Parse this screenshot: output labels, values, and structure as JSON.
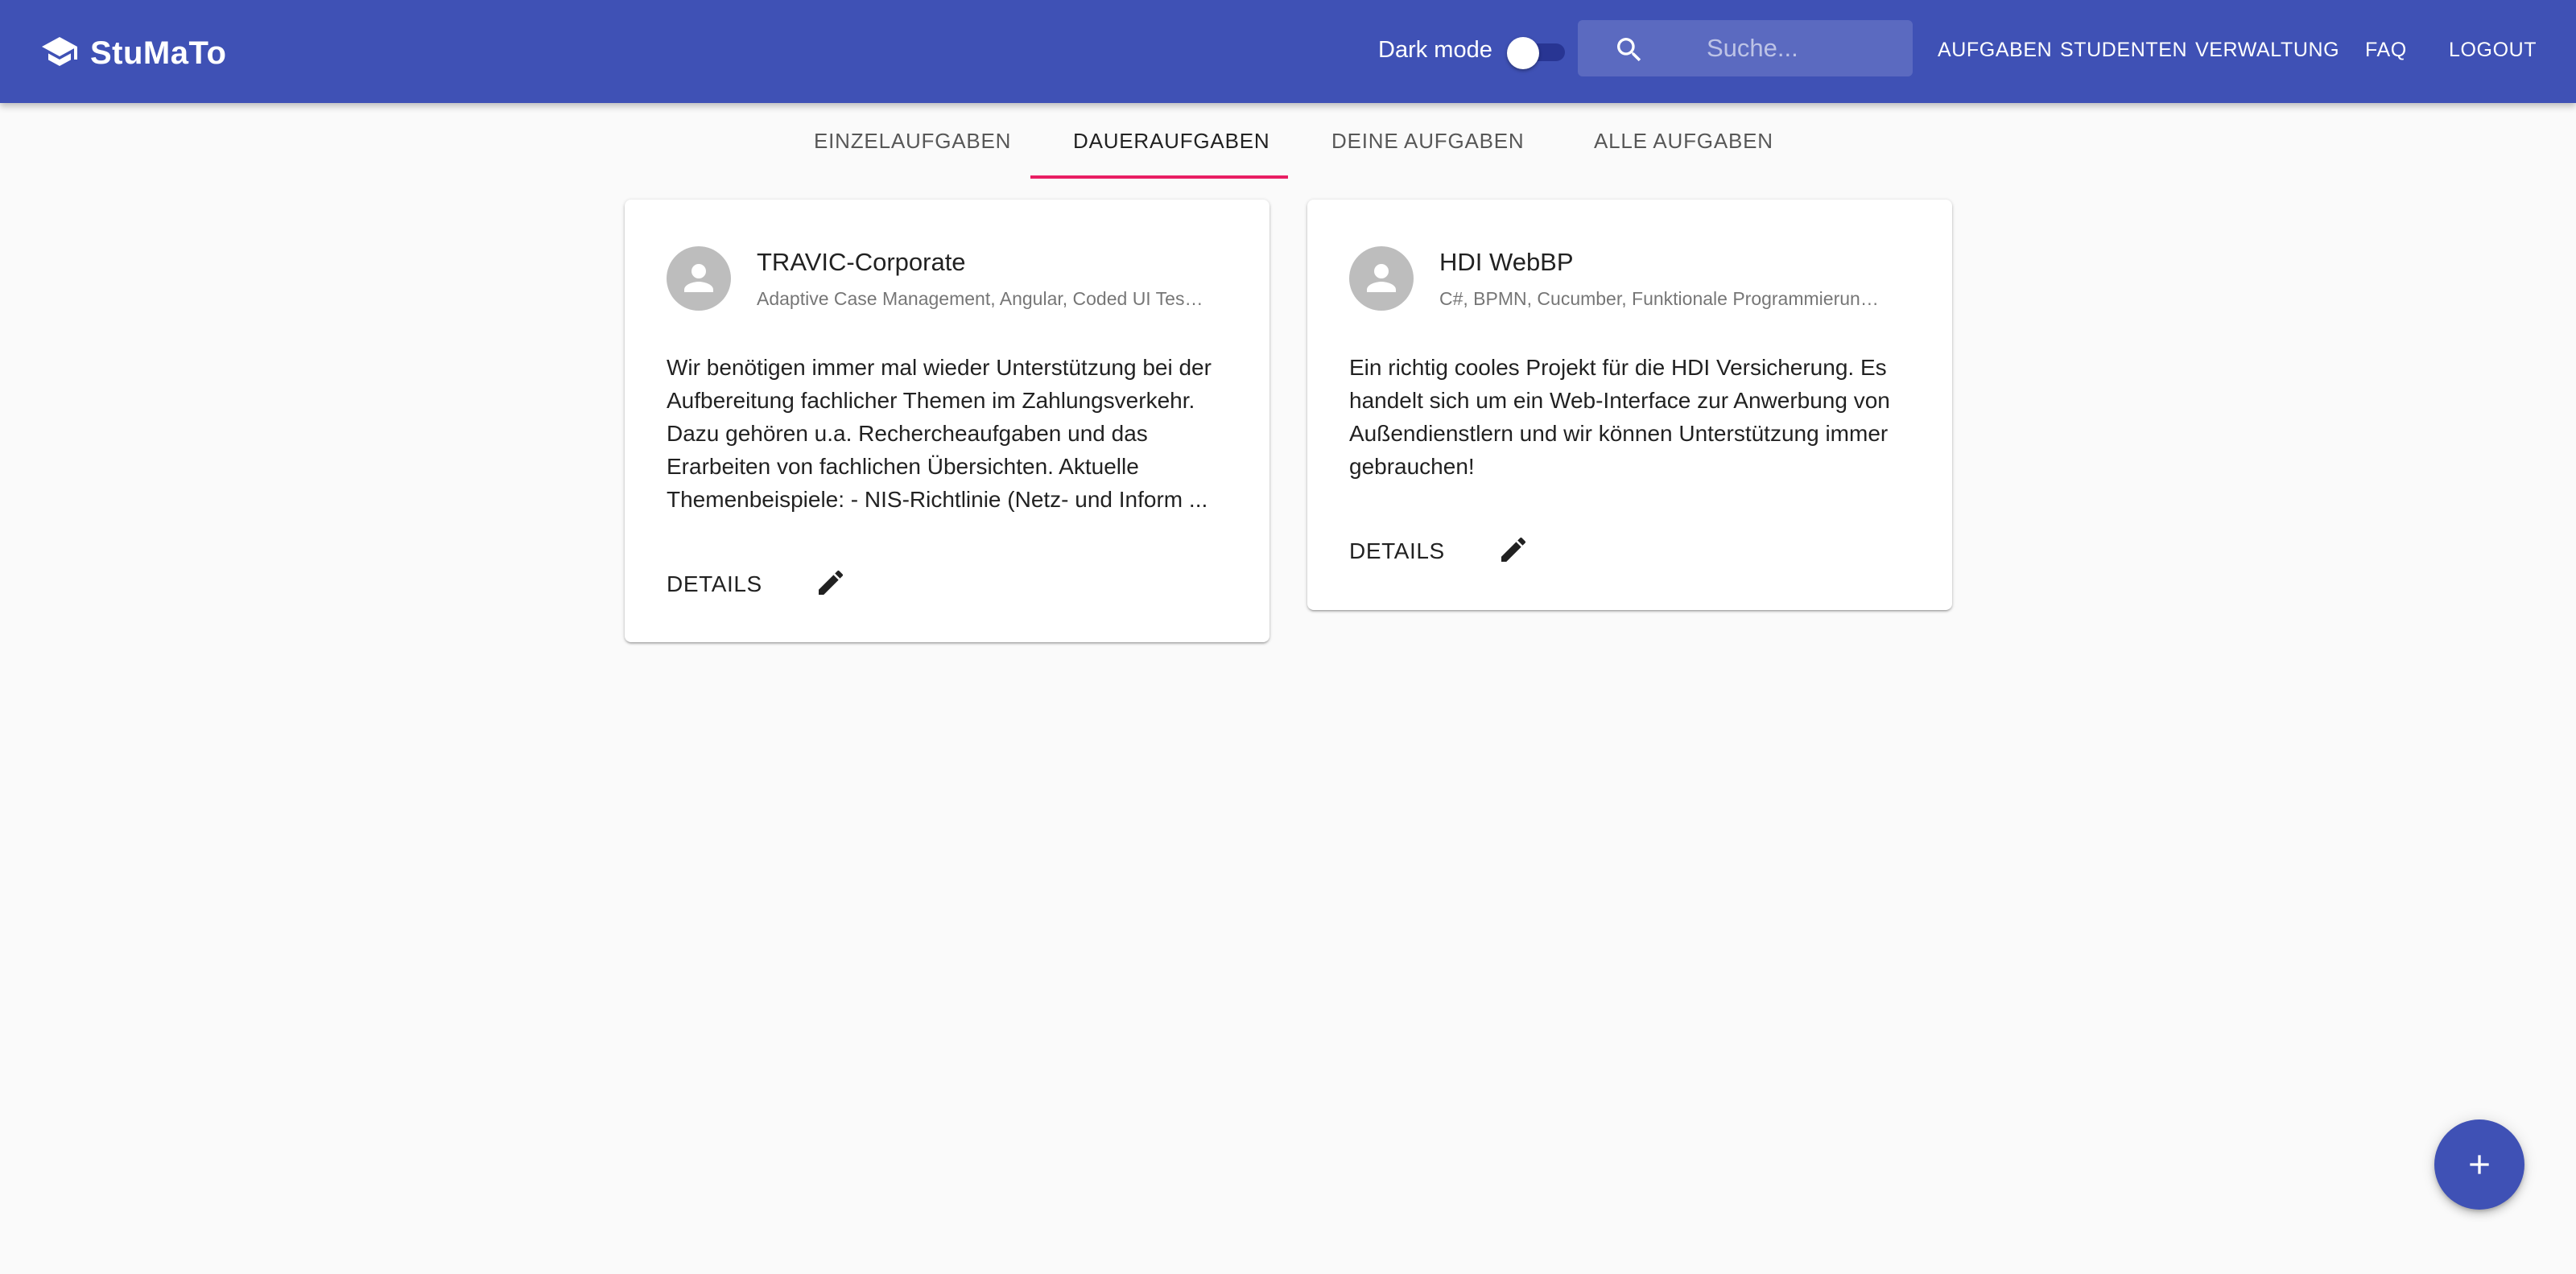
{
  "app": {
    "title": "StuMaTo",
    "logo_icon": "school-icon"
  },
  "header": {
    "dark_mode_label": "Dark mode",
    "dark_mode_on": false,
    "search": {
      "placeholder": "Suche...",
      "value": ""
    },
    "nav": [
      {
        "label": "AUFGABEN"
      },
      {
        "label": "STUDENTEN"
      },
      {
        "label": "VERWALTUNG"
      },
      {
        "label": "FAQ"
      },
      {
        "label": "LOGOUT"
      }
    ]
  },
  "tabs": [
    {
      "label": "EINZELAUFGABEN",
      "active": false
    },
    {
      "label": "DAUERAUFGABEN",
      "active": true
    },
    {
      "label": "DEINE AUFGABEN",
      "active": false
    },
    {
      "label": "ALLE AUFGABEN",
      "active": false
    }
  ],
  "cards": [
    {
      "title": "TRAVIC-Corporate",
      "subtitle": "Adaptive Case Management, Angular, Coded UI Tests, C#, Java",
      "body": "Wir benötigen immer mal wieder Unterstützung bei der Aufbereitung fachlicher Themen im Zahlungsverkehr. Dazu gehören u.a. Rechercheaufgaben und das Erarbeiten von fachlichen Übersichten. Aktuelle Themenbeispiele: - NIS-Richtlinie (Netz- und Inform ...",
      "action_label": "DETAILS"
    },
    {
      "title": "HDI WebBP",
      "subtitle": "C#, BPMN, Cucumber, Funktionale Programmierung, Java",
      "body": "Ein richtig cooles Projekt für die HDI Versicherung. Es handelt sich um ein Web-Interface zur Anwerbung von Außendienstlern und wir können Unterstützung immer gebrauchen!",
      "action_label": "DETAILS"
    }
  ],
  "colors": {
    "primary": "#3f51b5",
    "accent": "#e91e63",
    "background": "#fafafa"
  }
}
